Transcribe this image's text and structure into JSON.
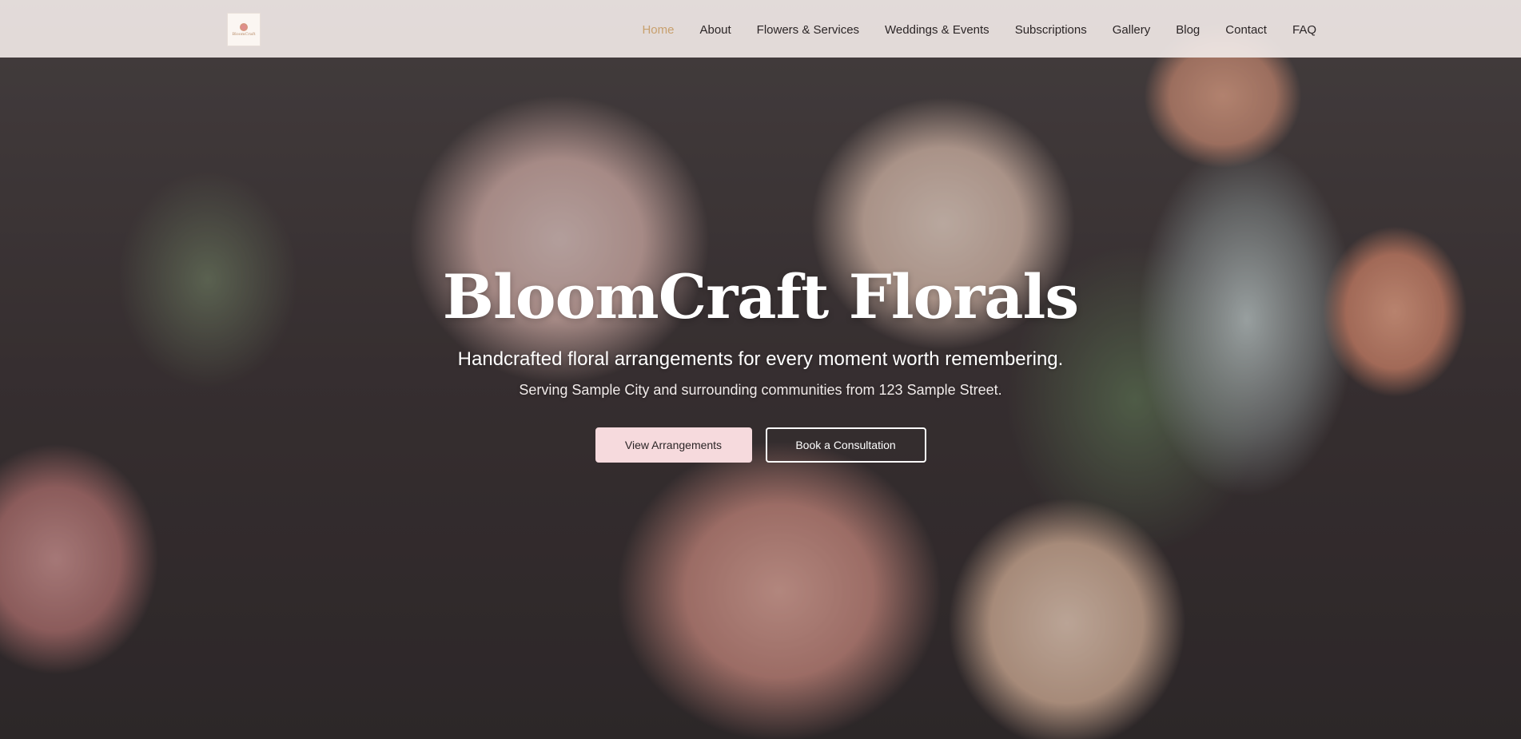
{
  "brand": {
    "logo_text": "BloomCraft",
    "logo_icon": "flower-logo-icon"
  },
  "nav": {
    "items": [
      {
        "label": "Home",
        "active": true
      },
      {
        "label": "About",
        "active": false
      },
      {
        "label": "Flowers & Services",
        "active": false
      },
      {
        "label": "Weddings & Events",
        "active": false
      },
      {
        "label": "Subscriptions",
        "active": false
      },
      {
        "label": "Gallery",
        "active": false
      },
      {
        "label": "Blog",
        "active": false
      },
      {
        "label": "Contact",
        "active": false
      },
      {
        "label": "FAQ",
        "active": false
      }
    ]
  },
  "hero": {
    "title": "BloomCraft Florals",
    "subtitle": "Handcrafted floral arrangements for every moment worth remembering.",
    "tagline": "Serving Sample City and surrounding communities from 123 Sample Street.",
    "primary_button": "View Arrangements",
    "secondary_button": "Book a Consultation"
  },
  "colors": {
    "accent": "#c8a06e",
    "primary_button_bg": "#f6dadd",
    "nav_bg": "#f0e8e6"
  }
}
